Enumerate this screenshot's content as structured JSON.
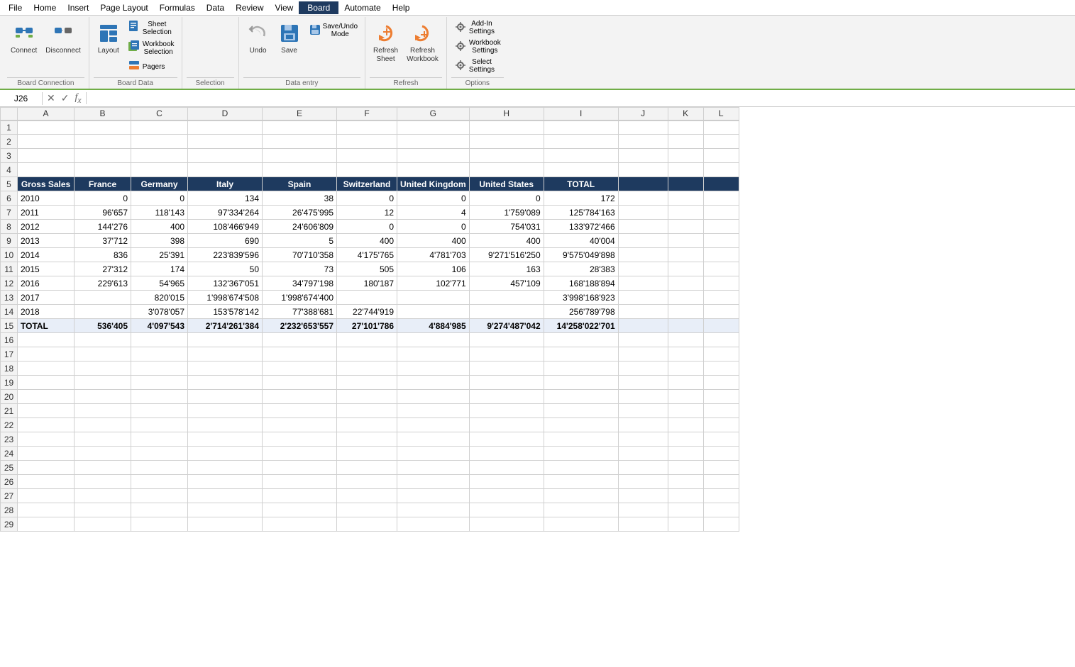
{
  "menu": {
    "items": [
      {
        "label": "File",
        "active": false
      },
      {
        "label": "Home",
        "active": false
      },
      {
        "label": "Insert",
        "active": false
      },
      {
        "label": "Page Layout",
        "active": false
      },
      {
        "label": "Formulas",
        "active": false
      },
      {
        "label": "Data",
        "active": false
      },
      {
        "label": "Review",
        "active": false
      },
      {
        "label": "View",
        "active": false
      },
      {
        "label": "Board",
        "active": true
      },
      {
        "label": "Automate",
        "active": false
      },
      {
        "label": "Help",
        "active": false
      }
    ]
  },
  "ribbon": {
    "groups": [
      {
        "name": "Board Connection",
        "buttons": [
          {
            "id": "connect",
            "label": "Connect",
            "icon": "🔗",
            "large": true
          },
          {
            "id": "disconnect",
            "label": "Disconnect",
            "icon": "🔌",
            "large": true
          }
        ]
      },
      {
        "name": "Board Data",
        "buttons": [
          {
            "id": "layout",
            "label": "Layout",
            "icon": "📋",
            "large": true
          },
          {
            "id": "sheet-selection",
            "label": "Sheet\nSelection",
            "icon": "📄",
            "large": false
          },
          {
            "id": "workbook-selection",
            "label": "Workbook\nSelection",
            "icon": "📊",
            "large": false
          },
          {
            "id": "pagers",
            "label": "Pagers",
            "icon": "📑",
            "large": false
          }
        ]
      },
      {
        "name": "Selection",
        "label": "Selection"
      },
      {
        "name": "Data entry",
        "buttons": [
          {
            "id": "undo",
            "label": "Undo",
            "icon": "↩",
            "large": true
          },
          {
            "id": "save",
            "label": "Save",
            "icon": "💾",
            "large": true
          },
          {
            "id": "save-undo-mode",
            "label": "Save/Undo\nMode",
            "icon": "💾",
            "large": false
          }
        ]
      },
      {
        "name": "Refresh",
        "buttons": [
          {
            "id": "refresh-sheet",
            "label": "Refresh\nSheet",
            "icon": "🔄",
            "large": true
          },
          {
            "id": "refresh-workbook",
            "label": "Refresh\nWorkbook",
            "icon": "🔄",
            "large": true
          }
        ]
      },
      {
        "name": "Options",
        "buttons": [
          {
            "id": "add-in-settings",
            "label": "Add-In\nSettings",
            "icon": "⚙",
            "large": false
          },
          {
            "id": "workbook-settings",
            "label": "Workbook\nSettings",
            "icon": "⚙",
            "large": false
          },
          {
            "id": "select-settings",
            "label": "Select\nSettings",
            "icon": "⚙",
            "large": false
          }
        ]
      }
    ]
  },
  "formula_bar": {
    "cell_ref": "J26",
    "formula": ""
  },
  "columns": {
    "headers": [
      "",
      "A",
      "B",
      "C",
      "D",
      "E",
      "F",
      "G",
      "H",
      "I",
      "J",
      "K",
      "L"
    ],
    "widths": [
      24,
      80,
      80,
      80,
      100,
      100,
      85,
      85,
      105,
      105,
      70,
      50,
      50
    ]
  },
  "rows": [
    {
      "row": 1,
      "cells": []
    },
    {
      "row": 2,
      "cells": []
    },
    {
      "row": 3,
      "cells": []
    },
    {
      "row": 4,
      "cells": []
    },
    {
      "row": 5,
      "header": true,
      "cells": [
        {
          "col": "A",
          "val": "Gross Sales",
          "align": "center"
        },
        {
          "col": "B",
          "val": "France",
          "align": "center"
        },
        {
          "col": "C",
          "val": "Germany",
          "align": "center"
        },
        {
          "col": "D",
          "val": "Italy",
          "align": "center"
        },
        {
          "col": "E",
          "val": "Spain",
          "align": "center"
        },
        {
          "col": "F",
          "val": "Switzerland",
          "align": "center"
        },
        {
          "col": "G",
          "val": "United Kingdom",
          "align": "center"
        },
        {
          "col": "H",
          "val": "United States",
          "align": "center"
        },
        {
          "col": "I",
          "val": "TOTAL",
          "align": "center"
        }
      ]
    },
    {
      "row": 6,
      "cells": [
        {
          "col": "A",
          "val": "2010",
          "align": "left"
        },
        {
          "col": "B",
          "val": "0",
          "align": "right"
        },
        {
          "col": "C",
          "val": "0",
          "align": "right"
        },
        {
          "col": "D",
          "val": "134",
          "align": "right"
        },
        {
          "col": "E",
          "val": "38",
          "align": "right"
        },
        {
          "col": "F",
          "val": "0",
          "align": "right"
        },
        {
          "col": "G",
          "val": "0",
          "align": "right"
        },
        {
          "col": "H",
          "val": "0",
          "align": "right"
        },
        {
          "col": "I",
          "val": "172",
          "align": "right"
        }
      ]
    },
    {
      "row": 7,
      "cells": [
        {
          "col": "A",
          "val": "2011",
          "align": "left"
        },
        {
          "col": "B",
          "val": "96'657",
          "align": "right"
        },
        {
          "col": "C",
          "val": "118'143",
          "align": "right"
        },
        {
          "col": "D",
          "val": "97'334'264",
          "align": "right"
        },
        {
          "col": "E",
          "val": "26'475'995",
          "align": "right"
        },
        {
          "col": "F",
          "val": "12",
          "align": "right"
        },
        {
          "col": "G",
          "val": "4",
          "align": "right"
        },
        {
          "col": "H",
          "val": "1'759'089",
          "align": "right"
        },
        {
          "col": "I",
          "val": "125'784'163",
          "align": "right"
        }
      ]
    },
    {
      "row": 8,
      "cells": [
        {
          "col": "A",
          "val": "2012",
          "align": "left"
        },
        {
          "col": "B",
          "val": "144'276",
          "align": "right"
        },
        {
          "col": "C",
          "val": "400",
          "align": "right"
        },
        {
          "col": "D",
          "val": "108'466'949",
          "align": "right"
        },
        {
          "col": "E",
          "val": "24'606'809",
          "align": "right"
        },
        {
          "col": "F",
          "val": "0",
          "align": "right"
        },
        {
          "col": "G",
          "val": "0",
          "align": "right"
        },
        {
          "col": "H",
          "val": "754'031",
          "align": "right"
        },
        {
          "col": "I",
          "val": "133'972'466",
          "align": "right"
        }
      ]
    },
    {
      "row": 9,
      "cells": [
        {
          "col": "A",
          "val": "2013",
          "align": "left"
        },
        {
          "col": "B",
          "val": "37'712",
          "align": "right"
        },
        {
          "col": "C",
          "val": "398",
          "align": "right"
        },
        {
          "col": "D",
          "val": "690",
          "align": "right"
        },
        {
          "col": "E",
          "val": "5",
          "align": "right"
        },
        {
          "col": "F",
          "val": "400",
          "align": "right"
        },
        {
          "col": "G",
          "val": "400",
          "align": "right"
        },
        {
          "col": "H",
          "val": "400",
          "align": "right"
        },
        {
          "col": "I",
          "val": "40'004",
          "align": "right"
        }
      ]
    },
    {
      "row": 10,
      "cells": [
        {
          "col": "A",
          "val": "2014",
          "align": "left"
        },
        {
          "col": "B",
          "val": "836",
          "align": "right"
        },
        {
          "col": "C",
          "val": "25'391",
          "align": "right"
        },
        {
          "col": "D",
          "val": "223'839'596",
          "align": "right"
        },
        {
          "col": "E",
          "val": "70'710'358",
          "align": "right"
        },
        {
          "col": "F",
          "val": "4'175'765",
          "align": "right"
        },
        {
          "col": "G",
          "val": "4'781'703",
          "align": "right"
        },
        {
          "col": "H",
          "val": "9'271'516'250",
          "align": "right"
        },
        {
          "col": "I",
          "val": "9'575'049'898",
          "align": "right"
        }
      ]
    },
    {
      "row": 11,
      "cells": [
        {
          "col": "A",
          "val": "2015",
          "align": "left"
        },
        {
          "col": "B",
          "val": "27'312",
          "align": "right"
        },
        {
          "col": "C",
          "val": "174",
          "align": "right"
        },
        {
          "col": "D",
          "val": "50",
          "align": "right"
        },
        {
          "col": "E",
          "val": "73",
          "align": "right"
        },
        {
          "col": "F",
          "val": "505",
          "align": "right"
        },
        {
          "col": "G",
          "val": "106",
          "align": "right"
        },
        {
          "col": "H",
          "val": "163",
          "align": "right"
        },
        {
          "col": "I",
          "val": "28'383",
          "align": "right"
        }
      ]
    },
    {
      "row": 12,
      "cells": [
        {
          "col": "A",
          "val": "2016",
          "align": "left"
        },
        {
          "col": "B",
          "val": "229'613",
          "align": "right"
        },
        {
          "col": "C",
          "val": "54'965",
          "align": "right"
        },
        {
          "col": "D",
          "val": "132'367'051",
          "align": "right"
        },
        {
          "col": "E",
          "val": "34'797'198",
          "align": "right"
        },
        {
          "col": "F",
          "val": "180'187",
          "align": "right"
        },
        {
          "col": "G",
          "val": "102'771",
          "align": "right"
        },
        {
          "col": "H",
          "val": "457'109",
          "align": "right"
        },
        {
          "col": "I",
          "val": "168'188'894",
          "align": "right"
        }
      ]
    },
    {
      "row": 13,
      "cells": [
        {
          "col": "A",
          "val": "2017",
          "align": "left"
        },
        {
          "col": "B",
          "val": "",
          "align": "right"
        },
        {
          "col": "C",
          "val": "820'015",
          "align": "right"
        },
        {
          "col": "D",
          "val": "1'998'674'508",
          "align": "right"
        },
        {
          "col": "E",
          "val": "1'998'674'400",
          "align": "right"
        },
        {
          "col": "F",
          "val": "",
          "align": "right"
        },
        {
          "col": "G",
          "val": "",
          "align": "right"
        },
        {
          "col": "H",
          "val": "",
          "align": "right"
        },
        {
          "col": "I",
          "val": "3'998'168'923",
          "align": "right"
        }
      ]
    },
    {
      "row": 14,
      "cells": [
        {
          "col": "A",
          "val": "2018",
          "align": "left"
        },
        {
          "col": "B",
          "val": "",
          "align": "right"
        },
        {
          "col": "C",
          "val": "3'078'057",
          "align": "right"
        },
        {
          "col": "D",
          "val": "153'578'142",
          "align": "right"
        },
        {
          "col": "E",
          "val": "77'388'681",
          "align": "right"
        },
        {
          "col": "F",
          "val": "22'744'919",
          "align": "right"
        },
        {
          "col": "G",
          "val": "",
          "align": "right"
        },
        {
          "col": "H",
          "val": "",
          "align": "right"
        },
        {
          "col": "I",
          "val": "256'789'798",
          "align": "right"
        }
      ]
    },
    {
      "row": 15,
      "total": true,
      "cells": [
        {
          "col": "A",
          "val": "TOTAL",
          "align": "left"
        },
        {
          "col": "B",
          "val": "536'405",
          "align": "right"
        },
        {
          "col": "C",
          "val": "4'097'543",
          "align": "right"
        },
        {
          "col": "D",
          "val": "2'714'261'384",
          "align": "right"
        },
        {
          "col": "E",
          "val": "2'232'653'557",
          "align": "right"
        },
        {
          "col": "F",
          "val": "27'101'786",
          "align": "right"
        },
        {
          "col": "G",
          "val": "4'884'985",
          "align": "right"
        },
        {
          "col": "H",
          "val": "9'274'487'042",
          "align": "right"
        },
        {
          "col": "I",
          "val": "14'258'022'701",
          "align": "right"
        }
      ]
    },
    {
      "row": 16,
      "cells": []
    },
    {
      "row": 17,
      "cells": []
    },
    {
      "row": 18,
      "cells": []
    },
    {
      "row": 19,
      "cells": []
    },
    {
      "row": 20,
      "cells": []
    },
    {
      "row": 21,
      "cells": []
    },
    {
      "row": 22,
      "cells": []
    },
    {
      "row": 23,
      "cells": []
    },
    {
      "row": 24,
      "cells": []
    },
    {
      "row": 25,
      "cells": []
    },
    {
      "row": 26,
      "cells": []
    },
    {
      "row": 27,
      "cells": []
    },
    {
      "row": 28,
      "cells": []
    },
    {
      "row": 29,
      "cells": []
    }
  ]
}
